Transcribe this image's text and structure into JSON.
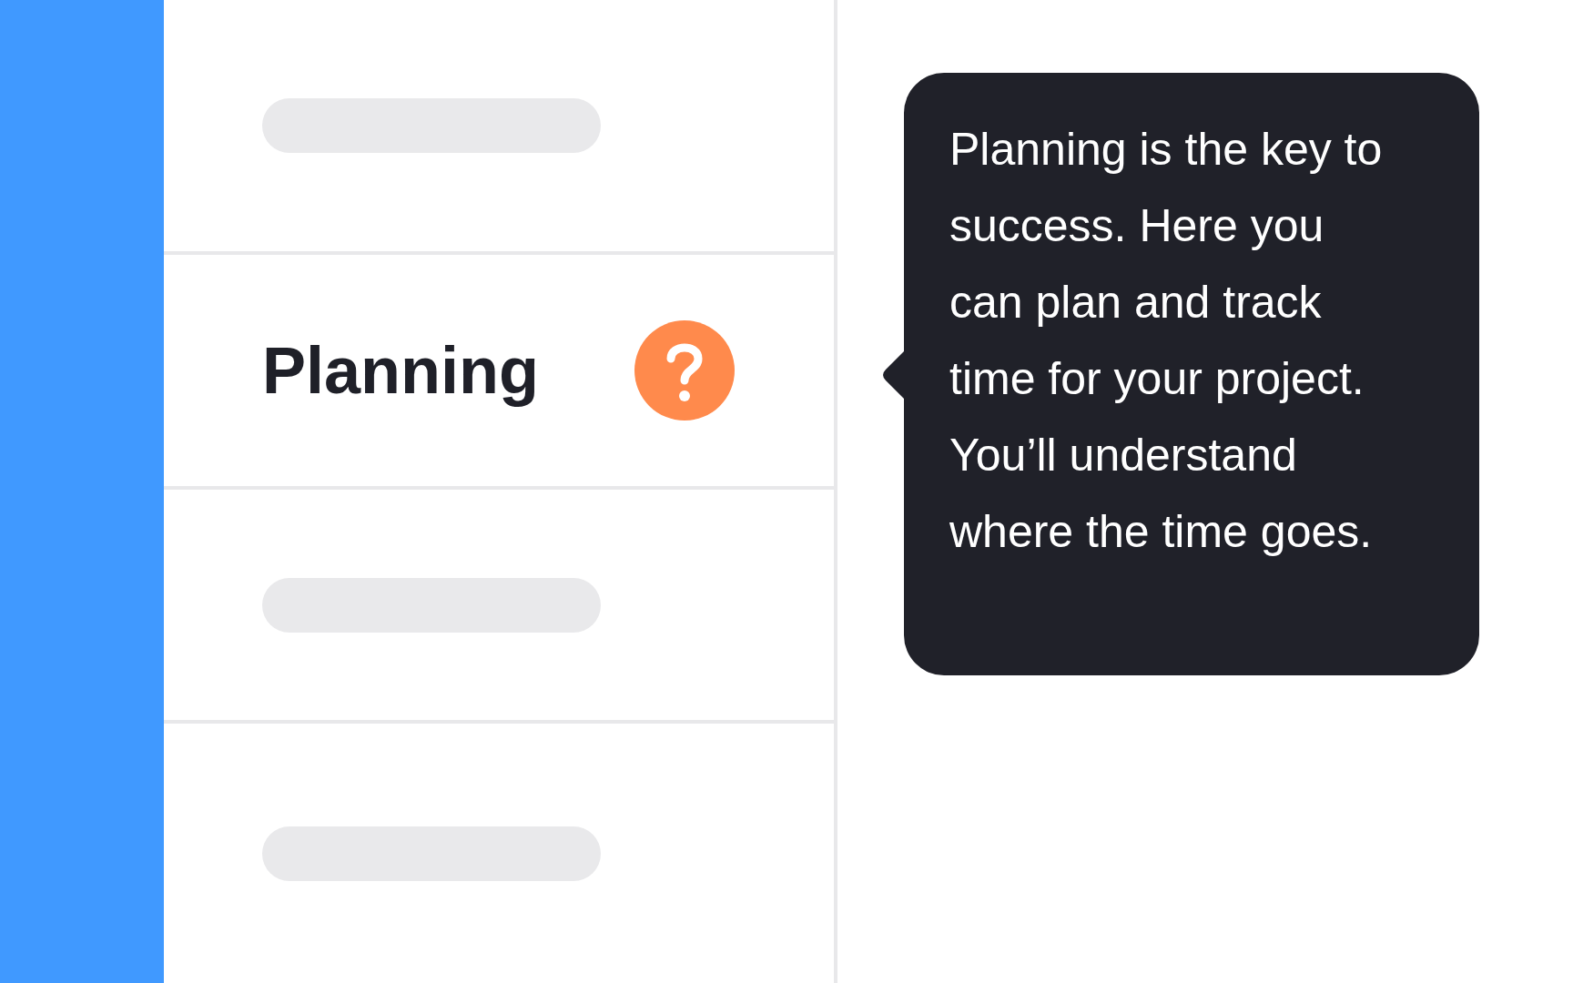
{
  "rows": [
    {
      "kind": "placeholder"
    },
    {
      "kind": "title",
      "label": "Planning",
      "help": true
    },
    {
      "kind": "placeholder"
    },
    {
      "kind": "placeholder"
    }
  ],
  "tooltip": {
    "text": "Planning is the key to success. Here you can plan and track time for your project. You’ll understand where the time goes."
  }
}
